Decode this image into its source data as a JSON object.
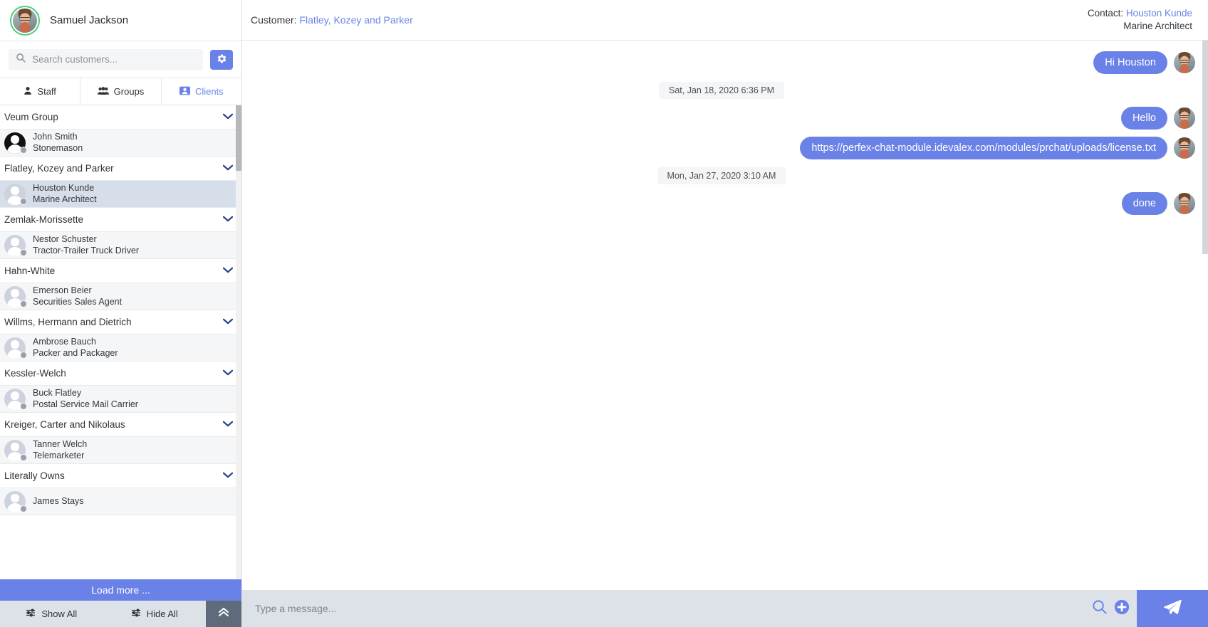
{
  "sidebar": {
    "user": {
      "name": "Samuel Jackson",
      "avatar_icon": "user-photo-avatar",
      "status_ring_color": "#4ad07d"
    },
    "search": {
      "placeholder": "Search customers...",
      "value": "",
      "icon": "search-icon"
    },
    "settings_button": {
      "icon": "gear-icon",
      "color": "#6a82e8"
    },
    "tabs": [
      {
        "label": "Staff",
        "icon": "user-icon",
        "active": false
      },
      {
        "label": "Groups",
        "icon": "users-group-icon",
        "active": false
      },
      {
        "label": "Clients",
        "icon": "address-card-icon",
        "active": true
      }
    ],
    "list": [
      {
        "type": "group",
        "label": "Veum Group",
        "chevron": "chevron-down-icon"
      },
      {
        "type": "person",
        "name": "John Smith",
        "role": "Stonemason",
        "avatar": "dark-user-avatar",
        "selected": false,
        "status": "offline"
      },
      {
        "type": "group",
        "label": "Flatley, Kozey and Parker",
        "chevron": "chevron-down-icon"
      },
      {
        "type": "person",
        "name": "Houston Kunde",
        "role": "Marine Architect",
        "avatar": "user-avatar",
        "selected": true,
        "status": "offline"
      },
      {
        "type": "group",
        "label": "Zemlak-Morissette",
        "chevron": "chevron-down-icon"
      },
      {
        "type": "person",
        "name": "Nestor Schuster",
        "role": "Tractor-Trailer Truck Driver",
        "avatar": "user-avatar",
        "selected": false,
        "status": "offline"
      },
      {
        "type": "group",
        "label": "Hahn-White",
        "chevron": "chevron-down-icon"
      },
      {
        "type": "person",
        "name": "Emerson Beier",
        "role": "Securities Sales Agent",
        "avatar": "user-avatar",
        "selected": false,
        "status": "offline"
      },
      {
        "type": "group",
        "label": "Willms, Hermann and Dietrich",
        "chevron": "chevron-down-icon"
      },
      {
        "type": "person",
        "name": "Ambrose Bauch",
        "role": "Packer and Packager",
        "avatar": "user-avatar",
        "selected": false,
        "status": "offline"
      },
      {
        "type": "group",
        "label": "Kessler-Welch",
        "chevron": "chevron-down-icon"
      },
      {
        "type": "person",
        "name": "Buck Flatley",
        "role": "Postal Service Mail Carrier",
        "avatar": "user-avatar",
        "selected": false,
        "status": "offline"
      },
      {
        "type": "group",
        "label": "Kreiger, Carter and Nikolaus",
        "chevron": "chevron-down-icon"
      },
      {
        "type": "person",
        "name": "Tanner Welch",
        "role": "Telemarketer",
        "avatar": "user-avatar",
        "selected": false,
        "status": "offline"
      },
      {
        "type": "group",
        "label": "Literally Owns",
        "chevron": "chevron-down-icon"
      },
      {
        "type": "person",
        "name": "James Stays",
        "role": "",
        "avatar": "user-avatar",
        "selected": false,
        "status": "offline"
      }
    ],
    "load_more_label": "Load more ...",
    "footer": {
      "show_all_label": "Show All",
      "hide_all_label": "Hide All",
      "sliders_icon": "sliders-icon",
      "collapse_icon": "chevron-double-up-icon"
    }
  },
  "chat": {
    "header": {
      "customer_prefix": "Customer:",
      "customer_name": "Flatley, Kozey and Parker",
      "contact_prefix": "Contact:",
      "contact_name": "Houston Kunde",
      "contact_role": "Marine Architect",
      "link_color": "#6a82e8"
    },
    "messages": [
      {
        "kind": "message",
        "text": "Hi Houston",
        "side": "right",
        "avatar": "user-photo-avatar"
      },
      {
        "kind": "date",
        "text": "Sat, Jan 18, 2020 6:36 PM"
      },
      {
        "kind": "message",
        "text": "Hello",
        "side": "right",
        "avatar": "user-photo-avatar"
      },
      {
        "kind": "message",
        "text": "https://perfex-chat-module.idevalex.com/modules/prchat/uploads/license.txt",
        "side": "right",
        "avatar": "user-photo-avatar"
      },
      {
        "kind": "date",
        "text": "Mon, Jan 27, 2020 3:10 AM"
      },
      {
        "kind": "message",
        "text": "done",
        "side": "right",
        "avatar": "user-photo-avatar"
      }
    ],
    "composer": {
      "placeholder": "Type a message...",
      "value": "",
      "search_icon": "search-icon",
      "attach_icon": "plus-circle-icon",
      "send_icon": "paper-plane-icon",
      "send_color": "#6a82e8"
    }
  }
}
